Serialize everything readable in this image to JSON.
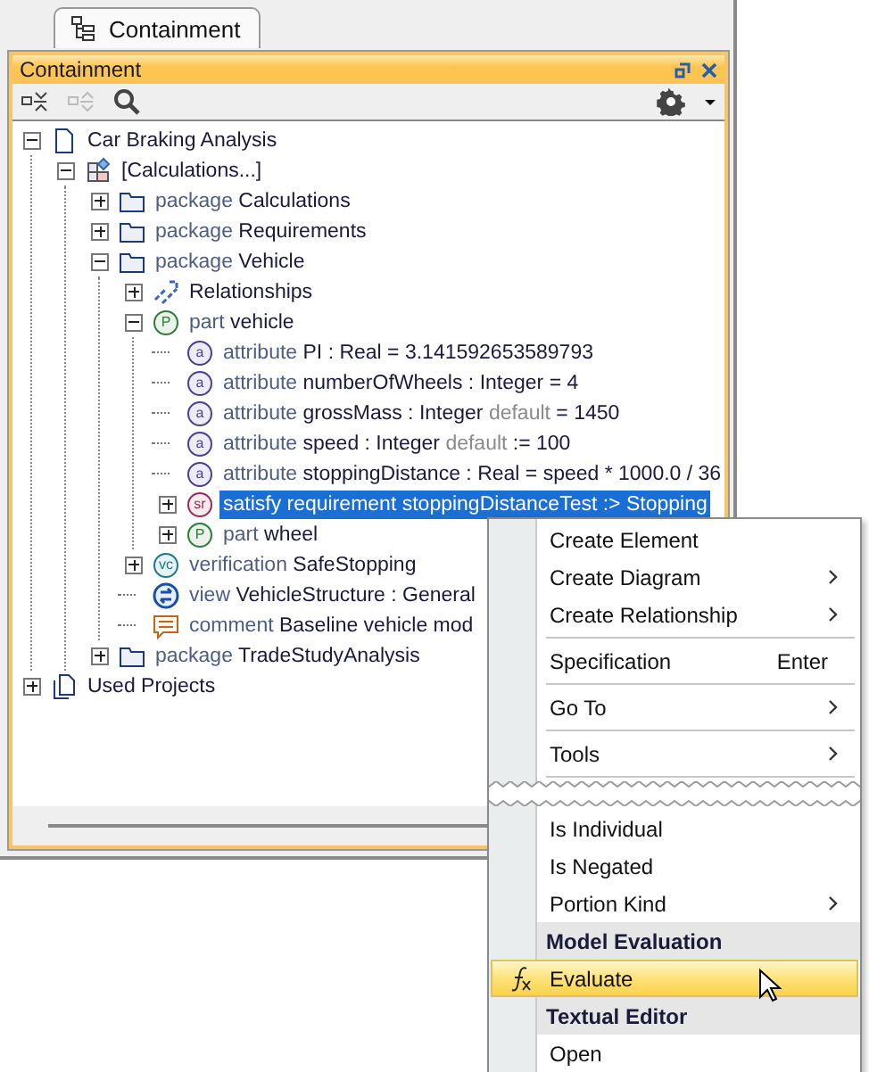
{
  "tab": {
    "label": "Containment",
    "selected": true
  },
  "panel": {
    "title": "Containment"
  },
  "tree": [
    {
      "kind": "document",
      "expanded": true,
      "selected": false,
      "label": [
        {
          "kind": "name",
          "text": "Car Braking Analysis"
        }
      ],
      "children": [
        {
          "kind": "block",
          "expanded": true,
          "selected": false,
          "label": [
            {
              "kind": "name",
              "text": "[Calculations...]"
            }
          ],
          "children": [
            {
              "kind": "folder",
              "expanded": false,
              "selected": false,
              "label": [
                {
                  "kind": "keyword",
                  "text": "package"
                },
                {
                  "kind": "name",
                  "text": " Calculations"
                }
              ]
            },
            {
              "kind": "folder",
              "expanded": false,
              "selected": false,
              "label": [
                {
                  "kind": "keyword",
                  "text": "package"
                },
                {
                  "kind": "name",
                  "text": " Requirements"
                }
              ]
            },
            {
              "kind": "folder",
              "expanded": true,
              "selected": false,
              "label": [
                {
                  "kind": "keyword",
                  "text": "package"
                },
                {
                  "kind": "name",
                  "text": " Vehicle"
                }
              ],
              "children": [
                {
                  "kind": "relationship",
                  "expanded": false,
                  "selected": false,
                  "label": [
                    {
                      "kind": "name",
                      "text": "Relationships"
                    }
                  ]
                },
                {
                  "kind": "badge",
                  "badge": "P",
                  "color": "#2f7d3a",
                  "expanded": true,
                  "selected": false,
                  "label": [
                    {
                      "kind": "keyword",
                      "text": "part"
                    },
                    {
                      "kind": "name",
                      "text": " vehicle"
                    }
                  ],
                  "children": [
                    {
                      "kind": "badge",
                      "badge": "a",
                      "color": "#4b3f9a",
                      "selected": false,
                      "label": [
                        {
                          "kind": "keyword",
                          "text": "attribute"
                        },
                        {
                          "kind": "name",
                          "text": " PI : Real = 3.141592653589793"
                        }
                      ]
                    },
                    {
                      "kind": "badge",
                      "badge": "a",
                      "color": "#4b3f9a",
                      "selected": false,
                      "label": [
                        {
                          "kind": "keyword",
                          "text": "attribute"
                        },
                        {
                          "kind": "name",
                          "text": " numberOfWheels : Integer = 4"
                        }
                      ]
                    },
                    {
                      "kind": "badge",
                      "badge": "a",
                      "color": "#4b3f9a",
                      "selected": false,
                      "label": [
                        {
                          "kind": "keyword",
                          "text": "attribute"
                        },
                        {
                          "kind": "name",
                          "text": " grossMass : Integer "
                        },
                        {
                          "kind": "muted",
                          "text": "default"
                        },
                        {
                          "kind": "name",
                          "text": " = 1450"
                        }
                      ]
                    },
                    {
                      "kind": "badge",
                      "badge": "a",
                      "color": "#4b3f9a",
                      "selected": false,
                      "label": [
                        {
                          "kind": "keyword",
                          "text": "attribute"
                        },
                        {
                          "kind": "name",
                          "text": " speed : Integer "
                        },
                        {
                          "kind": "muted",
                          "text": "default"
                        },
                        {
                          "kind": "name",
                          "text": " := 100"
                        }
                      ]
                    },
                    {
                      "kind": "badge",
                      "badge": "a",
                      "color": "#4b3f9a",
                      "selected": false,
                      "label": [
                        {
                          "kind": "keyword",
                          "text": "attribute"
                        },
                        {
                          "kind": "name",
                          "text": " stoppingDistance : Real = speed * 1000.0 / 36"
                        }
                      ]
                    },
                    {
                      "kind": "badge",
                      "badge": "sr",
                      "color": "#9b2d55",
                      "expanded": false,
                      "selected": true,
                      "label": [
                        {
                          "kind": "keyword",
                          "text": "satisfy requirement"
                        },
                        {
                          "kind": "name",
                          "text": " stoppingDistanceTest :> Stopping"
                        }
                      ]
                    },
                    {
                      "kind": "badge",
                      "badge": "P",
                      "color": "#2f7d3a",
                      "expanded": false,
                      "selected": false,
                      "label": [
                        {
                          "kind": "keyword",
                          "text": "part"
                        },
                        {
                          "kind": "name",
                          "text": " wheel"
                        }
                      ]
                    }
                  ]
                },
                {
                  "kind": "badge",
                  "badge": "vc",
                  "color": "#1a7a8a",
                  "expanded": false,
                  "selected": false,
                  "label": [
                    {
                      "kind": "keyword",
                      "text": "verification"
                    },
                    {
                      "kind": "name",
                      "text": " SafeStopping"
                    }
                  ]
                },
                {
                  "kind": "view",
                  "selected": false,
                  "label": [
                    {
                      "kind": "keyword",
                      "text": "view"
                    },
                    {
                      "kind": "name",
                      "text": " VehicleStructure : General"
                    }
                  ]
                },
                {
                  "kind": "comment",
                  "selected": false,
                  "label": [
                    {
                      "kind": "keyword",
                      "text": "comment"
                    },
                    {
                      "kind": "name",
                      "text": " Baseline vehicle mod"
                    }
                  ]
                }
              ]
            },
            {
              "kind": "folder",
              "expanded": false,
              "selected": false,
              "label": [
                {
                  "kind": "keyword",
                  "text": "package"
                },
                {
                  "kind": "name",
                  "text": " TradeStudyAnalysis"
                }
              ]
            }
          ]
        }
      ]
    },
    {
      "kind": "projects",
      "expanded": false,
      "selected": false,
      "label": [
        {
          "kind": "name",
          "text": "Used Projects"
        }
      ]
    }
  ],
  "context_menu": [
    {
      "kind": "item",
      "label": "Create Element",
      "submenu": false,
      "selected": false
    },
    {
      "kind": "item",
      "label": "Create Diagram",
      "submenu": true,
      "selected": false
    },
    {
      "kind": "item",
      "label": "Create Relationship",
      "submenu": true,
      "selected": false
    },
    {
      "kind": "separator"
    },
    {
      "kind": "item",
      "label": "Specification",
      "shortcut": "Enter",
      "submenu": false,
      "selected": false
    },
    {
      "kind": "separator"
    },
    {
      "kind": "item",
      "label": "Go To",
      "submenu": true,
      "selected": false
    },
    {
      "kind": "separator"
    },
    {
      "kind": "item",
      "label": "Tools",
      "submenu": true,
      "selected": false
    },
    {
      "kind": "separator"
    },
    {
      "kind": "break"
    },
    {
      "kind": "item",
      "label": "Is Individual",
      "submenu": false,
      "selected": false
    },
    {
      "kind": "item",
      "label": "Is Negated",
      "submenu": false,
      "selected": false
    },
    {
      "kind": "item",
      "label": "Portion Kind",
      "submenu": true,
      "selected": false
    },
    {
      "kind": "header",
      "label": "Model Evaluation"
    },
    {
      "kind": "item",
      "label": "Evaluate",
      "formula_icon": true,
      "submenu": false,
      "selected": true
    },
    {
      "kind": "header",
      "label": "Textual Editor"
    },
    {
      "kind": "item",
      "label": "Open",
      "submenu": false,
      "selected": false
    }
  ]
}
